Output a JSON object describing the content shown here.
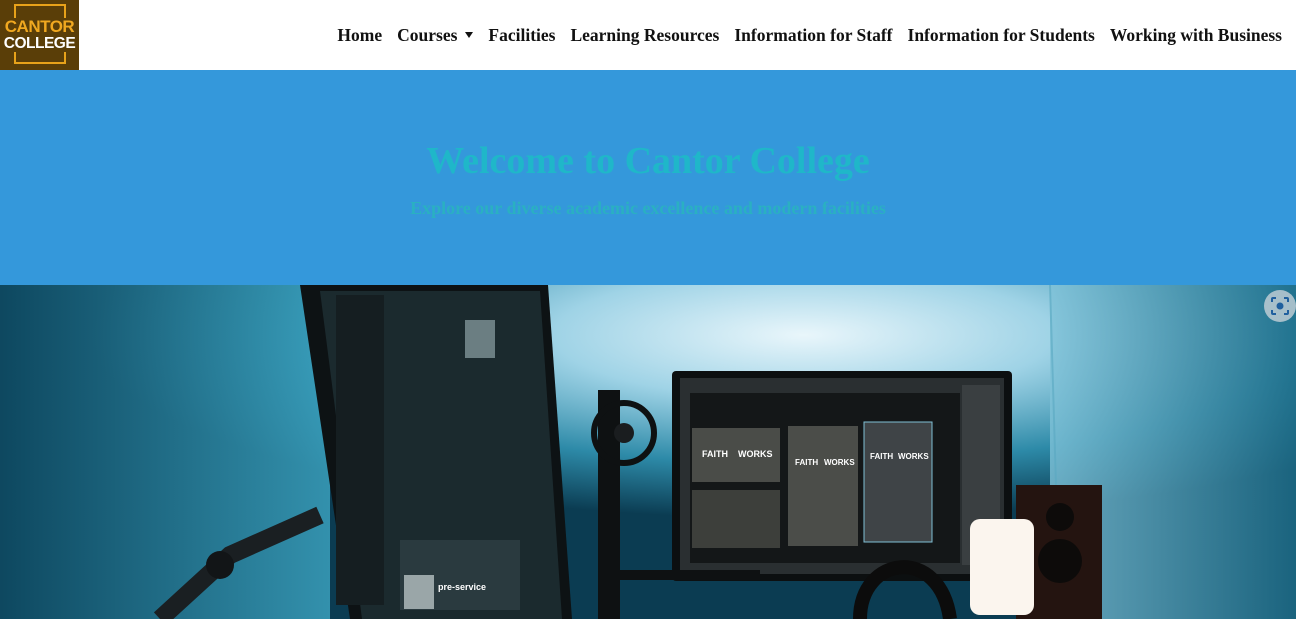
{
  "header": {
    "logo": {
      "line1": "CANTOR",
      "line2": "COLLEGE"
    },
    "nav": [
      {
        "label": "Home"
      },
      {
        "label": "Courses",
        "has_dropdown": true
      },
      {
        "label": "Facilities"
      },
      {
        "label": "Learning Resources"
      },
      {
        "label": "Information for Staff"
      },
      {
        "label": "Information for Students"
      },
      {
        "label": "Working with Business"
      }
    ]
  },
  "hero": {
    "title": "Welcome to Cantor College",
    "subtitle": "Explore our diverse academic excellence and modern facilities"
  },
  "colors": {
    "hero_background": "#3498db",
    "hero_text": "#1fb7c9",
    "logo_background": "#5a3e08",
    "logo_accent": "#f0a820"
  },
  "photo": {
    "poster_text": [
      "FAITH",
      "WORKS",
      "FAITH",
      "WORKS",
      "FAITH",
      "WORKS"
    ],
    "screen_text": "pre-service"
  },
  "icons": {
    "visual_search": "lens-icon",
    "nav_dropdown": "caret-down-icon"
  }
}
